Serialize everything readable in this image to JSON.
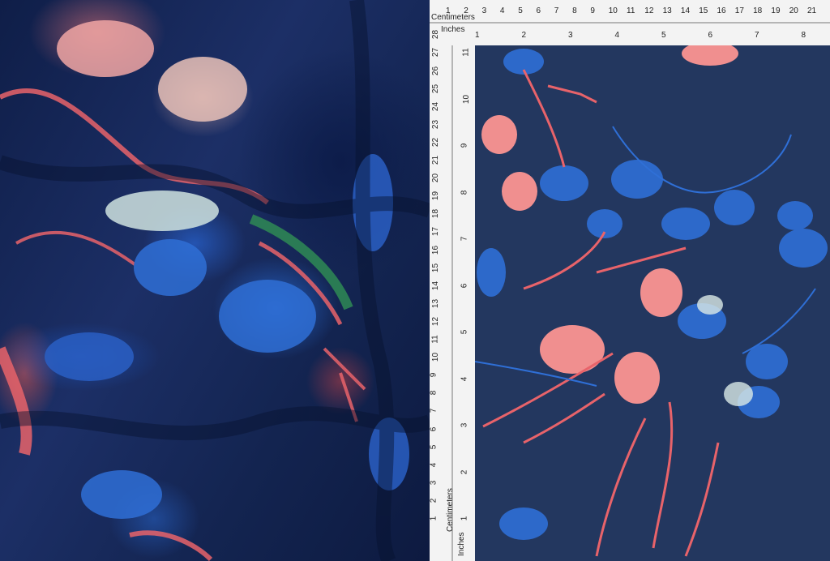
{
  "image": {
    "description_kind": "product-photo",
    "colors": {
      "navy": "#1b2a52",
      "blue": "#2f6fd6",
      "coral": "#e8636a",
      "pink": "#f1a6a4",
      "green": "#2f8a55",
      "ruler": "#f3f3f3"
    }
  },
  "ruler_top": {
    "cm_label": "Centimeters",
    "in_label": "Inches",
    "cm_ticks": [
      "1",
      "2",
      "3",
      "4",
      "5",
      "6",
      "7",
      "8",
      "9",
      "10",
      "11",
      "12",
      "13",
      "14",
      "15",
      "16",
      "17",
      "18",
      "19",
      "20",
      "21"
    ],
    "in_ticks": [
      "1",
      "2",
      "3",
      "4",
      "5",
      "6",
      "7",
      "8"
    ]
  },
  "ruler_left": {
    "cm_label": "Centimeters",
    "in_label": "Inches",
    "cm_ticks": [
      "1",
      "2",
      "3",
      "4",
      "5",
      "6",
      "7",
      "8",
      "9",
      "10",
      "11",
      "12",
      "13",
      "14",
      "15",
      "16",
      "17",
      "18",
      "19",
      "20",
      "21",
      "22",
      "23",
      "24",
      "25",
      "26",
      "27",
      "28"
    ],
    "in_ticks": [
      "1",
      "2",
      "3",
      "4",
      "5",
      "6",
      "7",
      "8",
      "9",
      "10",
      "11"
    ]
  }
}
